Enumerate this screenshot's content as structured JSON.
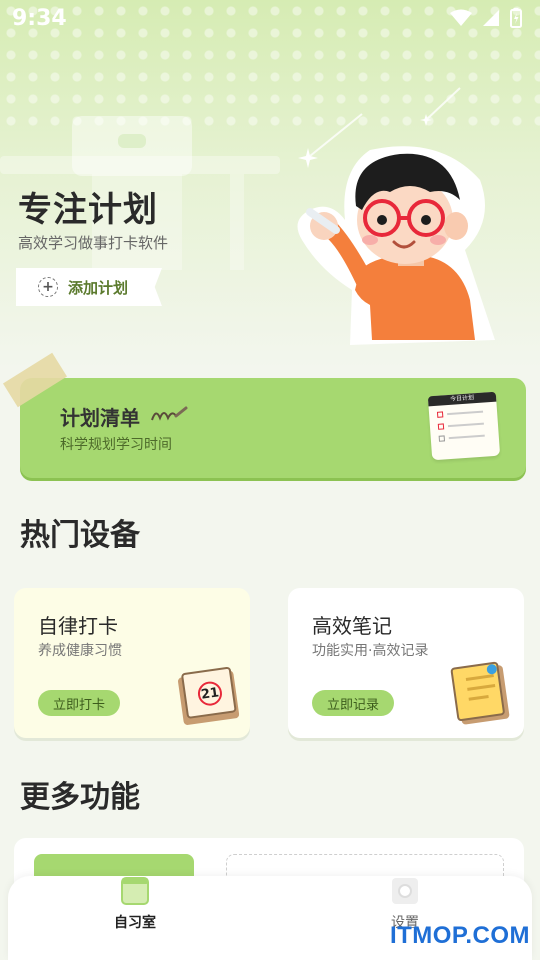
{
  "status_bar": {
    "time": "9:34"
  },
  "hero": {
    "title": "专注计划",
    "subtitle": "高效学习做事打卡软件",
    "add_button": "添加计划",
    "illustration": "boy-with-glasses"
  },
  "plan_card": {
    "title": "计划清单",
    "subtitle": "科学规划学习时间",
    "note_title": "今日计划"
  },
  "hot_section": {
    "title": "热门设备",
    "cards": [
      {
        "title": "自律打卡",
        "subtitle": "养成健康习惯",
        "button": "立即打卡",
        "icon": "calendar-icon",
        "calendar_day": "21"
      },
      {
        "title": "高效笔记",
        "subtitle": "功能实用·高效记录",
        "button": "立即记录",
        "icon": "notebook-icon"
      }
    ]
  },
  "more_section": {
    "title": "更多功能"
  },
  "bottom_nav": {
    "items": [
      {
        "label": "自习室",
        "active": true
      },
      {
        "label": "设置",
        "active": false
      }
    ]
  },
  "watermark": "ITMOP.COM",
  "colors": {
    "accent": "#a6d870",
    "accent_dark": "#8cc252",
    "background": "#f3f6ee",
    "watermark": "#1f6fd6"
  }
}
